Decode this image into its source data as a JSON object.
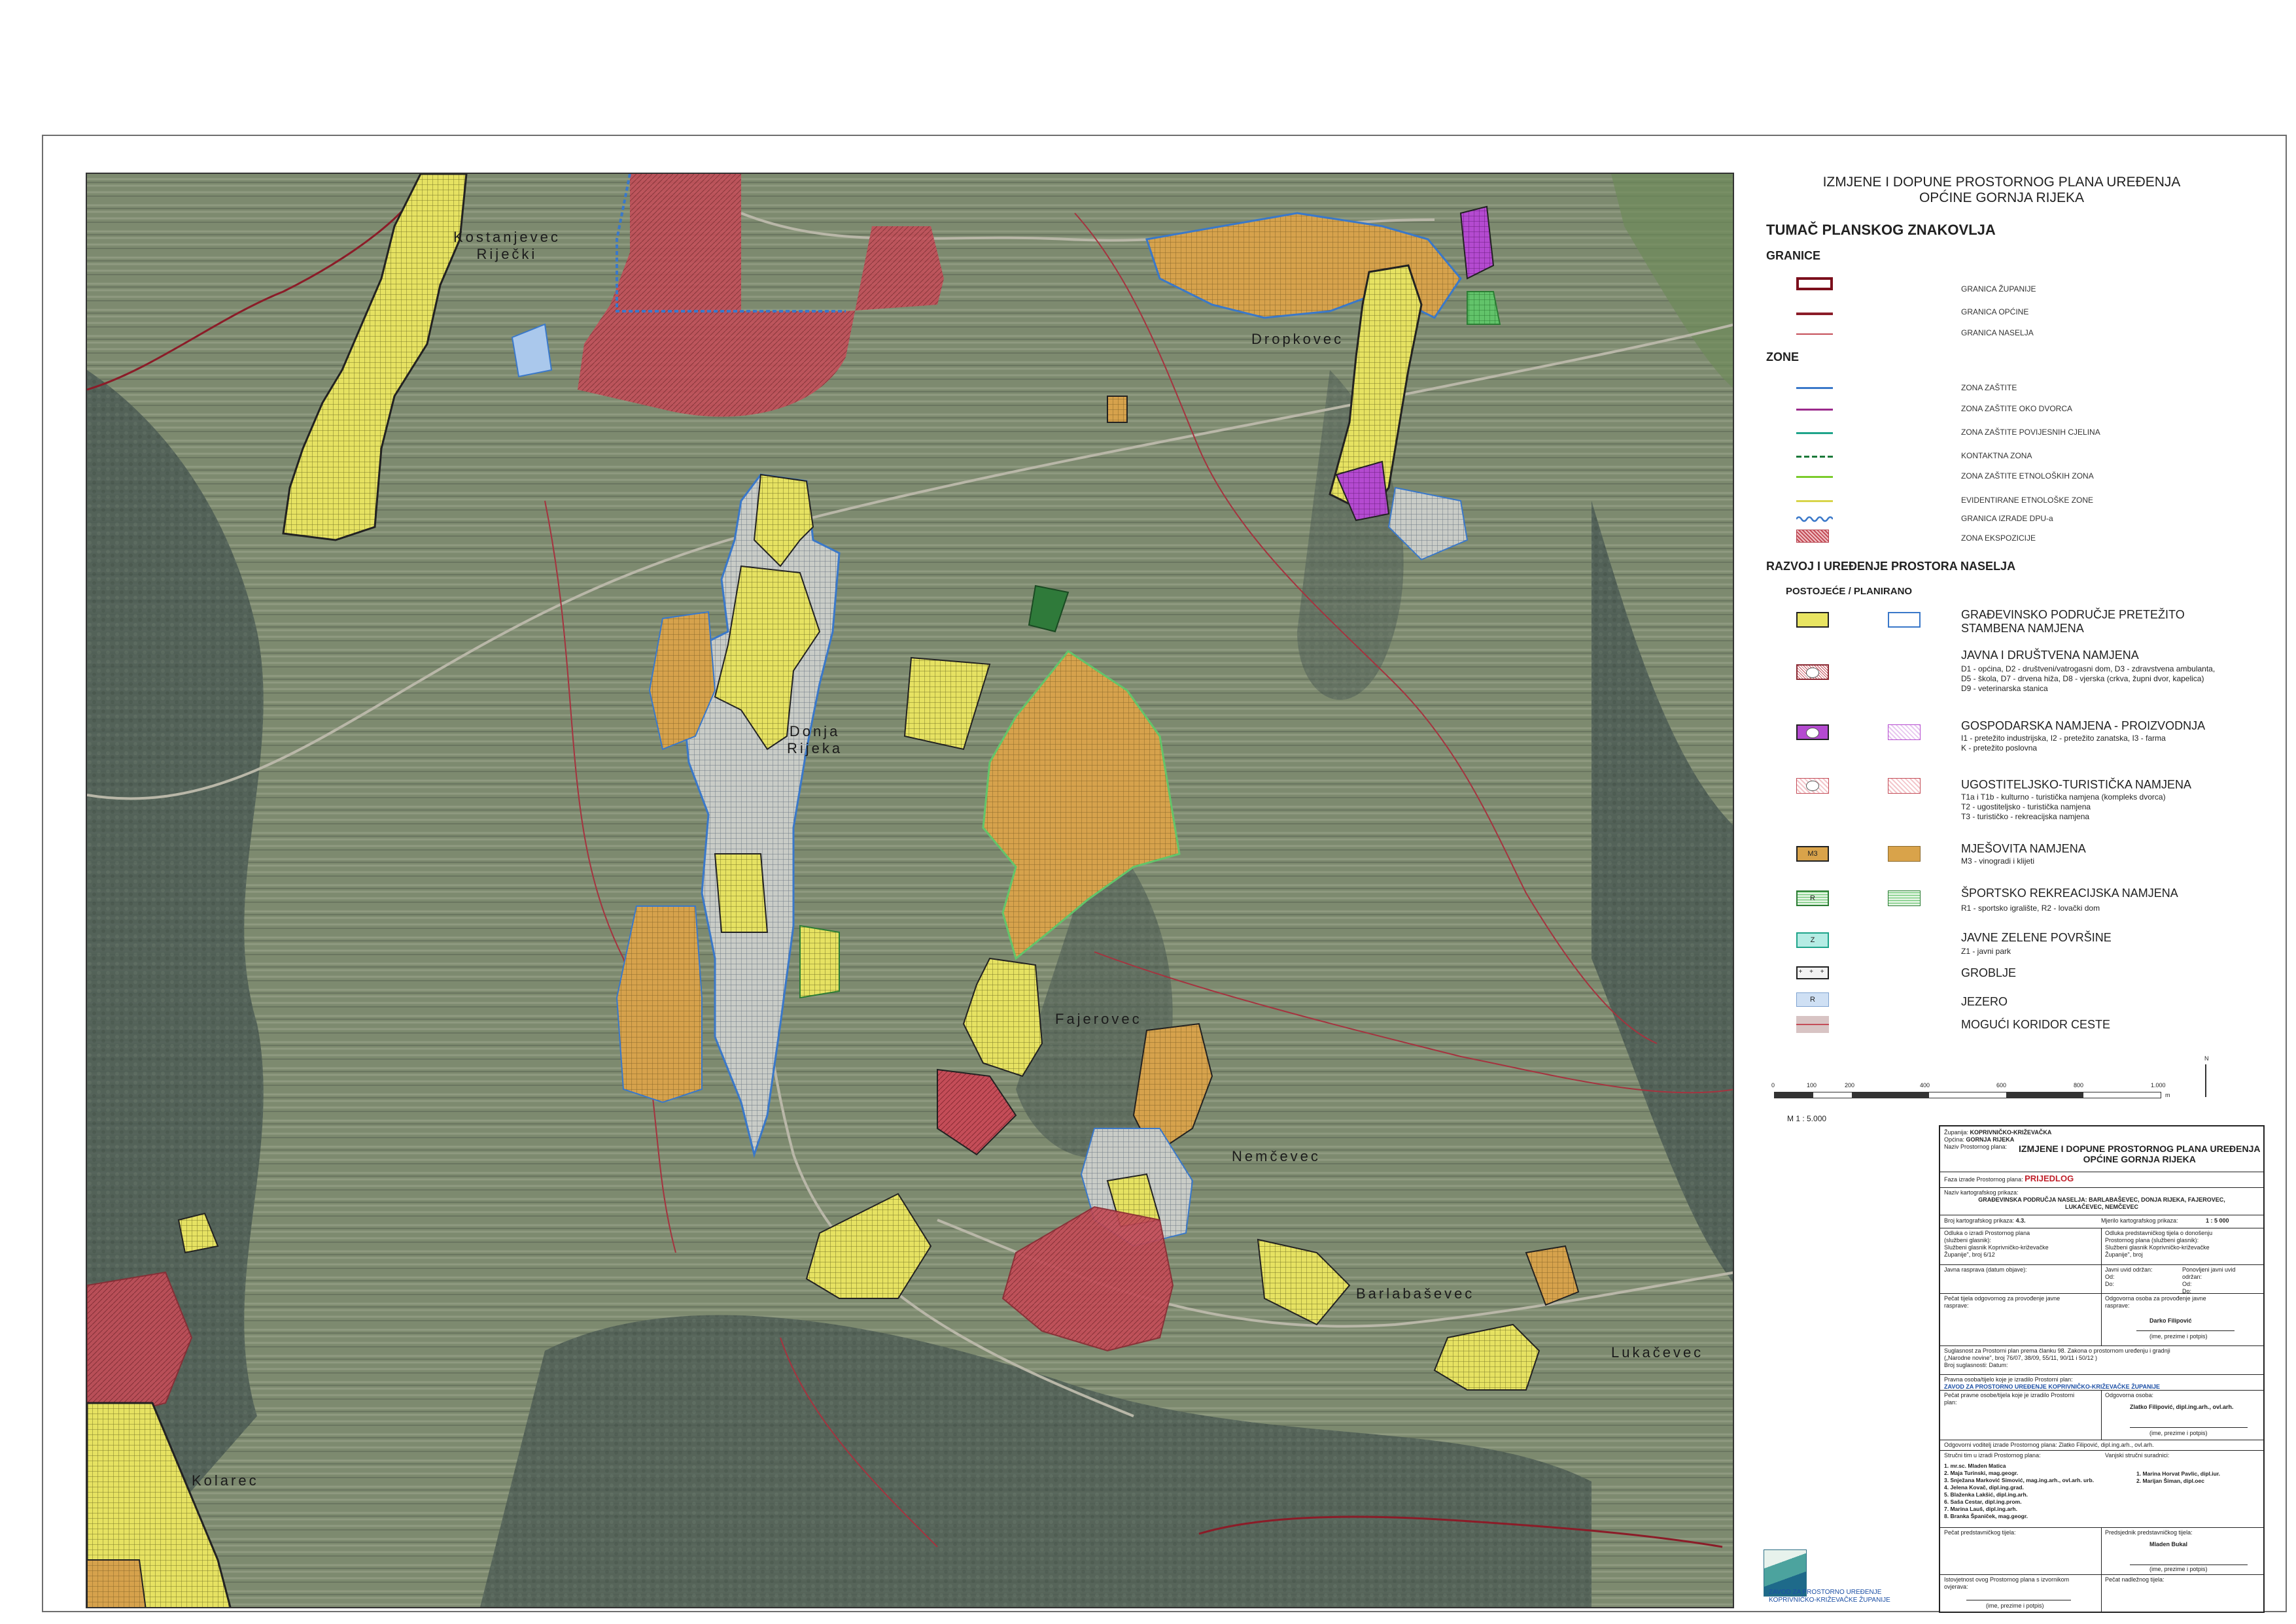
{
  "header": {
    "title_line1": "IZMJENE I DOPUNE PROSTORNOG PLANA UREĐENJA",
    "title_line2": "OPĆINE GORNJA RIJEKA"
  },
  "legend": {
    "main_heading": "TUMAČ PLANSKOG ZNAKOVLJA",
    "granice": {
      "heading": "GRANICE",
      "items": [
        "GRANICA ŽUPANIJE",
        "GRANICA OPĆINE",
        "GRANICA NASELJA"
      ]
    },
    "zone": {
      "heading": "ZONE",
      "items": [
        "ZONA ZAŠTITE",
        "ZONA ZAŠTITE OKO DVORCA",
        "ZONA ZAŠTITE POVIJESNIH CJELINA",
        "KONTAKTNA ZONA",
        "ZONA ZAŠTITE ETNOLOŠKIH ZONA",
        "EVIDENTIRANE ETNOLOŠKE ZONE",
        "GRANICA IZRADE DPU-a",
        "ZONA EKSPOZICIJE"
      ]
    },
    "razvoj": {
      "heading": "RAZVOJ I UREĐENJE PROSTORA NASELJA",
      "subheading": "POSTOJEĆE  /  PLANIRANO",
      "items": [
        {
          "label": "GRAĐEVINSKO PODRUČJE PRETEŽITO\nSTAMBENA NAMJENA",
          "desc": "",
          "symbol": ""
        },
        {
          "label": "JAVNA I DRUŠTVENA NAMJENA",
          "desc": "D1 - općina, D2 - društveni/vatrogasni dom, D3 - zdravstvena ambulanta,\nD5 - škola, D7 - drvena hiža, D8 - vjerska (crkva, župni dvor, kapelica)\nD9 - veterinarska stanica",
          "symbol": ""
        },
        {
          "label": "GOSPODARSKA  NAMJENA - PROIZVODNJA",
          "desc": "I1 - pretežito industrijska, I2 - pretežito zanatska, I3 - farma\nK - pretežito poslovna",
          "symbol": ""
        },
        {
          "label": "UGOSTITELJSKO-TURISTIČKA NAMJENA",
          "desc": "T1a i T1b - kulturno - turistička namjena (kompleks dvorca)\nT2 - ugostiteljsko - turistička namjena\nT3 - turističko - rekreacijska namjena",
          "symbol": ""
        },
        {
          "label": "MJEŠOVITA NAMJENA",
          "desc": "M3 - vinogradi i klijeti",
          "symbol": "M3"
        },
        {
          "label": "ŠPORTSKO REKREACIJSKA NAMJENA",
          "desc": "R1 - sportsko igralište, R2 - lovački dom",
          "symbol": "R"
        },
        {
          "label": "JAVNE ZELENE POVRŠINE",
          "desc": "Z1 - javni park",
          "symbol": "Z"
        },
        {
          "label": "GROBLJE",
          "desc": "",
          "symbol": ""
        },
        {
          "label": "JEZERO",
          "desc": "",
          "symbol": "R"
        },
        {
          "label": "MOGUĆI KORIDOR CESTE",
          "desc": "",
          "symbol": ""
        }
      ]
    },
    "scale_bar": {
      "ticks": [
        "0",
        "100",
        "200",
        "400",
        "600",
        "800",
        "1.000"
      ],
      "unit": "m",
      "north": "N",
      "scale_text": "M 1 : 5.000"
    }
  },
  "map": {
    "places": [
      "Kostanjevec\nRiječki",
      "Dropkovec",
      "Donja\nRijeka",
      "Fajerovec",
      "Nemčevec",
      "Barlabaševec",
      "Lukačevec",
      "Kolarec"
    ],
    "colors": {
      "residential_yellow": "#e8e462",
      "mixed_orange": "#d9a34a",
      "public_red": "#c94d57",
      "business_purple": "#b44ad0",
      "sport_green": "#63c46a",
      "planned_blue": "#3a78c9",
      "municipal_border": "#8b1c28"
    }
  },
  "title_block": {
    "zupanija_label": "Županija:",
    "zupanija": "KOPRIVNIČKO-KRIŽEVAČKA",
    "opcina_label": "Općina:",
    "opcina": "GORNJA RIJEKA",
    "plan_label": "Naziv Prostornog plana:",
    "plan_name": "IZMJENE I DOPUNE PROSTORNOG PLANA UREĐENJA\nOPĆINE GORNJA RIJEKA",
    "faza_label": "Faza izrade Prostornog plana:",
    "faza": "PRIJEDLOG",
    "prikaz_label": "Naziv kartografskog prikaza:",
    "prikaz": "GRAĐEVINSKA PODRUČJA NASELJA:  BARLABAŠEVEC, DONJA RIJEKA, FAJEROVEC,\nLUKAČEVEC, NEMČEVEC",
    "broj_label": "Broj kartografskog prikaza:",
    "broj": "4.3.",
    "mjerilo_label": "Mjerilo kartografskog prikaza:",
    "mjerilo": "1 : 5 000",
    "odluka_izrada": "Odluka o izradi Prostornog plana\n(službeni glasnik):\nSlužbeni glasnik Koprivničko-križevačke\nŽupanije\", broj 6/12",
    "odluka_donosenje": "Odluka predstavničkog tijela o donošenju\nProstornog plana (službeni glasnik):\nSlužbeni glasnik Koprivničko-križevačke\nŽupanije\", broj",
    "javna_rasprava": "Javna rasprava (datum objave):",
    "javni_uvid": "Javni uvid održan:\nOd:\nDo:",
    "ponovljeni_uvid": "Ponovljeni javni uvid\nodržan:\nOd:\nDo:",
    "pecat_tijela": "Pečat tijela odgovornog za provođenje javne\nrasprave:",
    "odgovorna_osoba_rasprava": "Odgovorna osoba za provođenje javne\nrasprave:",
    "odgovorna_ime_1": "Darko Filipović",
    "suglasnost": "Suglasnost za Prostorni plan prema članku 98. Zakona o prostornom uređenju i gradnji\n(„Narodne novine\", broj 76/07, 38/09, 55/11, 90/11 i 50/12 )\nBroj suglasnosti:                 Datum:",
    "izradivac_label": "Pravna osoba/tijelo koje je izradilo Prostorni plan:",
    "izradivac": "ZAVOD ZA PROSTORNO UREĐENJE KOPRIVNIČKO-KRIŽEVAČKE ŽUPANIJE",
    "pecat_pravne": "Pečat pravne osobe/tijela koje je izradilo Prostorni\nplan:",
    "odgovorna_osoba_label": "Odgovorna osoba:",
    "odgovorna_osoba": "Zlatko Filipović, dipl.ing.arh., ovl.arh.",
    "ime_potpis": "(ime, prezime i potpis)",
    "koordinator": "Odgovorni voditelj izrade Prostornog plana:  Zlatko Filipović, dipl.ing.arh., ovl.arh.",
    "strucni_tim_label": "Stručni tim u izradi Prostornog plana:",
    "vanjski_label": "Vanjski stručni suradnici:",
    "strucni_tim": "1. mr.sc. Mladen Matica\n2. Maja Turinski, mag.geogr.\n3. Snježana Marković Simović, mag.ing.arh., ovl.arh. urb.\n4. Jelena Kovač, dipl.ing.grad.\n5. Blaženka Lakšić, dipl.ing.arh.\n6. Saša Cestar, dipl.ing.prom.\n7. Marina Lauš, dipl.ing.arh.\n8. Branka Španiček, mag.geogr.",
    "vanjski": "1. Marina Horvat Pavlic, dipl.iur.\n2. Marijan Šiman, dipl.oec",
    "pecat_predstavnickog": "Pečat predstavničkog tijela:",
    "predsjednik_label": "Predsjednik predstavničkog tijela:",
    "predsjednik": "Mladen Bukal",
    "istovjetnost": "Istovjetnost ovog Prostornog plana s izvornikom\novjerava:",
    "pecat_nadleznog": "Pečat nadležnog tijela:",
    "logo_text": "ZAVOD ZA PROSTORNO UREĐENJE\nKOPRIVNIČKO-KRIŽEVAČKE ŽUPANIJE"
  }
}
